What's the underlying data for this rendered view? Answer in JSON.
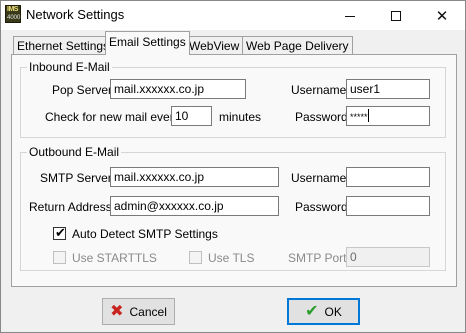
{
  "window": {
    "title": "Network Settings",
    "app_icon_text_top": "IMS",
    "app_icon_text_bottom": "4000",
    "controls": {
      "minimize": "─",
      "maximize": "☐",
      "close": "✕"
    }
  },
  "tabs": [
    {
      "label": "Ethernet Settings",
      "active": false
    },
    {
      "label": "Email Settings",
      "active": true
    },
    {
      "label": "WebView",
      "active": false
    },
    {
      "label": "Web Page Delivery",
      "active": false
    }
  ],
  "inbound": {
    "legend": "Inbound E-Mail",
    "pop_server_label": "Pop Server:",
    "pop_server_value": "mail.xxxxxx.co.jp",
    "check_label": "Check for new mail every",
    "check_value": "10",
    "check_unit": "minutes",
    "username_label": "Username:",
    "username_value": "user1",
    "password_label": "Password:",
    "password_value": "*****"
  },
  "outbound": {
    "legend": "Outbound E-Mail",
    "smtp_server_label": "SMTP Server:",
    "smtp_server_value": "mail.xxxxxx.co.jp",
    "return_address_label": "Return Address:",
    "return_address_value": "admin@xxxxxx.co.jp",
    "username_label": "Username:",
    "username_value": "",
    "password_label": "Password:",
    "password_value": "",
    "auto_detect_label": "Auto Detect SMTP Settings",
    "auto_detect_checked": true,
    "use_starttls_label": "Use STARTTLS",
    "use_starttls_checked": false,
    "use_tls_label": "Use TLS",
    "use_tls_checked": false,
    "smtp_port_label": "SMTP Port:",
    "smtp_port_value": "0"
  },
  "buttons": {
    "cancel_label": "Cancel",
    "cancel_icon": "x-icon",
    "ok_label": "OK",
    "ok_icon": "checkmark-icon"
  },
  "colors": {
    "cancel_icon": "#c8231f",
    "ok_icon": "#2a9d2a",
    "default_button_border": "#0078d7"
  }
}
